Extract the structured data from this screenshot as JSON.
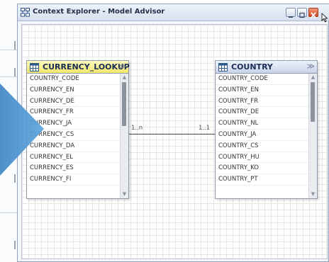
{
  "window": {
    "title": "Context Explorer - Model Advisor",
    "buttons": [
      "minimize",
      "maximize",
      "close"
    ]
  },
  "entities": [
    {
      "name": "CURRENCY_LOOKUP",
      "icon": "table-icon",
      "header_color": "#f6ef8a",
      "columns": [
        "COUNTRY_CODE",
        "CURRENCY_EN",
        "CURRENCY_DE",
        "CURRENCY_FR",
        "CURRENCY_JA",
        "CURRENCY_CS",
        "CURRENCY_DA",
        "CURRENCY_EL",
        "CURRENCY_ES",
        "CURRENCY_FI"
      ]
    },
    {
      "name": "COUNTRY",
      "icon": "table-icon",
      "header_color": "#d3dcef",
      "columns": [
        "COUNTRY_CODE",
        "COUNTRY_EN",
        "COUNTRY_FR",
        "COUNTRY_DE",
        "COUNTRY_NL",
        "COUNTRY_JA",
        "COUNTRY_CS",
        "COUNTRY_HU",
        "COUNTRY_KO",
        "COUNTRY_PT"
      ]
    }
  ],
  "relationship": {
    "left_cardinality": "1..n",
    "right_cardinality": "1..1"
  },
  "colors": {
    "accent": "#4a90c9",
    "title_bar": "#dde6f3",
    "close_button": "#e06a43"
  }
}
